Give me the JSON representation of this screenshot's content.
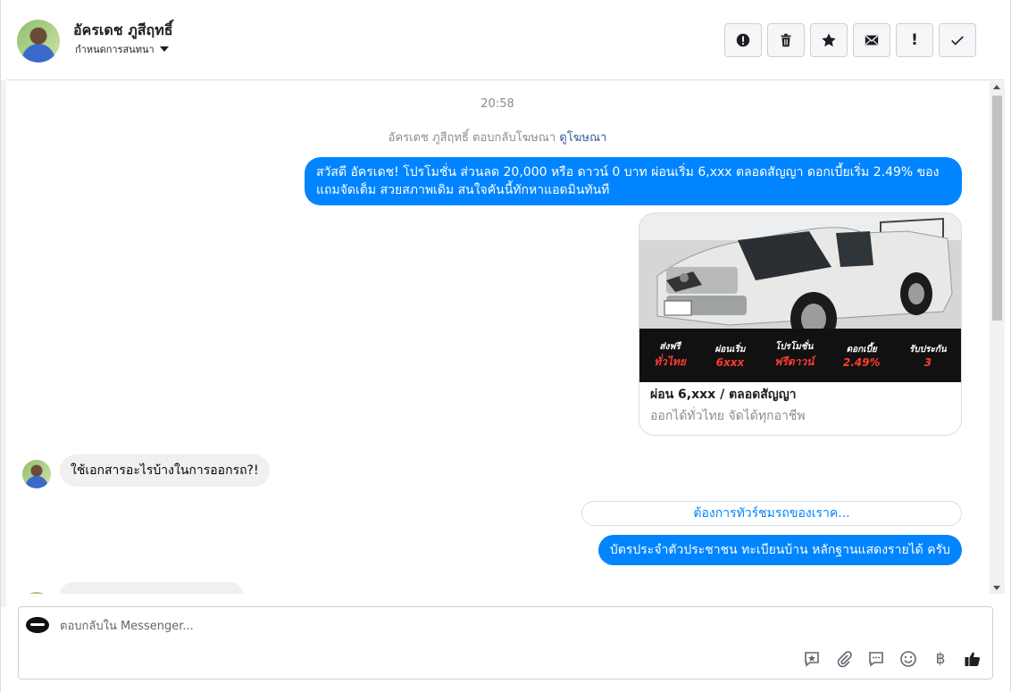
{
  "header": {
    "contact_name": "อัครเดช ภูสีฤทธิ์",
    "assign_label": "กำหนดการสนทนา",
    "tools": [
      "spam-icon",
      "trash-icon",
      "star-icon",
      "mail-icon",
      "exclamation-icon",
      "check-icon"
    ]
  },
  "chat": {
    "timestamp": "20:58",
    "ad_reply_prefix": "อัครเดช ภูสีฤทธิ์ ตอบกลับโฆษณา",
    "ad_reply_link": "ดูโฆษณา",
    "outgoing_1": "สวัสดี อัครเดช! โปรโมชั่น ส่วนลด 20,000 หรือ ดาวน์ 0 บาท ผ่อนเริ่ม 6,xxx ตลอดสัญญา ดอกเบี้ยเริ่ม 2.49% ของแถมจัดเต็ม สวยสภาพเดิม สนใจคันนี้ทักหาแอดมินทันที",
    "card": {
      "promo": [
        {
          "top": "ส่งฟรี",
          "bottom": "ทั่วไทย"
        },
        {
          "top": "ผ่อนเริ่ม",
          "bottom": "6xxx"
        },
        {
          "top": "โปรโมชั่น",
          "bottom": "ฟรีดาวน์"
        },
        {
          "top": "ดอกเบี้ย",
          "bottom": "2.49%"
        },
        {
          "top": "รับประกัน",
          "bottom": "3"
        }
      ],
      "title": "ผ่อน 6,xxx / ตลอดสัญญา",
      "subtitle": "ออกได้ทั่วไทย จัดได้ทุกอาชีพ"
    },
    "incoming_1": "ใช้เอกสารอะไรบ้างในการออกรถ?!",
    "quick_reply": "ต้องการทัวร์ชมรถของเราค...",
    "outgoing_2": "บัตรประจำตัวประชาชน ทะเบียนบ้าน หลักฐานแสดงรายได้ ครับ"
  },
  "composer": {
    "placeholder": "ตอบกลับใน Messenger...",
    "tools": [
      "sticker-reply-icon",
      "attachment-icon",
      "saved-reply-icon",
      "emoji-icon",
      "baht-icon",
      "like-icon"
    ],
    "baht_symbol": "฿"
  },
  "colors": {
    "accent": "#0084ff",
    "incoming_bubble": "#f0f0f0",
    "link": "#385898"
  }
}
